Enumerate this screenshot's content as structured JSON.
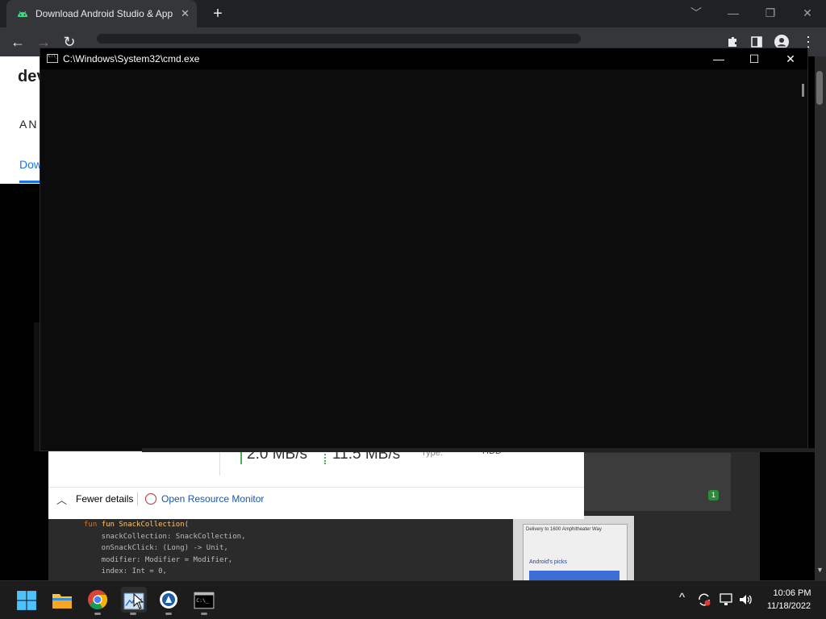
{
  "chrome": {
    "tab_title": "Download Android Studio & App",
    "tab_close": "✕",
    "new_tab": "+",
    "minimize": "﹀",
    "minimize2": "—",
    "restore": "❐",
    "close": "✕",
    "back": "←",
    "forward": "→",
    "reload": "↻",
    "menu": "⋮"
  },
  "webpage": {
    "logo": "dev",
    "nav_text": "AN",
    "tab_text": "Dow"
  },
  "task_manager": {
    "read_speed": "2.0 MB/s",
    "write_speed": "11.5 MB/s",
    "type_label": "Type:",
    "type_value": "HDD",
    "fewer_details": "Fewer details",
    "open_resource_monitor": "Open Resource Monitor"
  },
  "background_window": {
    "badge_count": "1",
    "code_lines": [
      "fun SnackCollection(",
      "    snackCollection: SnackCollection,",
      "    onSnackClick: (Long) -> Unit,",
      "    modifier: Modifier = Modifier,",
      "    index: Int = 0,"
    ],
    "phone_text": "Delivery to 1600 Amphitheater Way",
    "phone_heading": "Android's picks"
  },
  "cmd": {
    "title": "C:\\Windows\\System32\\cmd.exe",
    "minimize": "—",
    "maximize": "☐",
    "close": "✕"
  },
  "taskbar": {
    "time": "10:06 PM",
    "date": "11/18/2022",
    "chevron": "^"
  },
  "colors": {
    "cmd_bg": "#0c0c0c",
    "chrome_bg": "#35363a",
    "accent_blue": "#1a73e8",
    "taskbar_bg": "#1c1c1c"
  }
}
